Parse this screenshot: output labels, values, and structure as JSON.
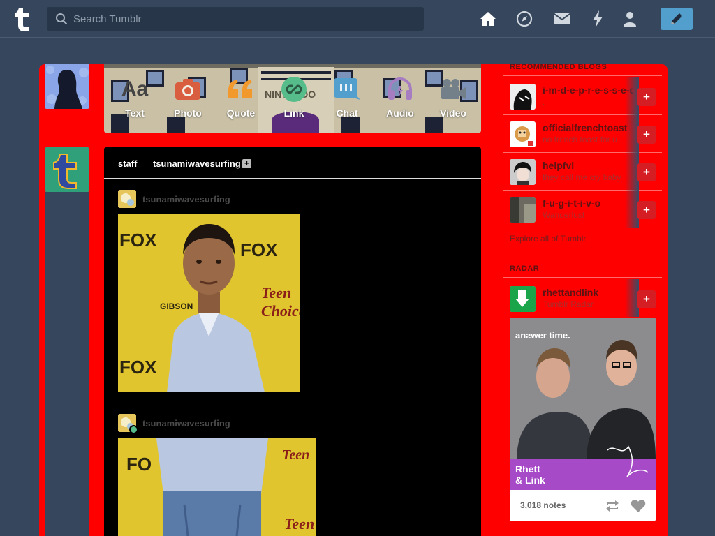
{
  "topbar": {
    "search_placeholder": "Search Tumblr",
    "nav_icons": [
      "home-icon",
      "explore-icon",
      "inbox-icon",
      "activity-icon",
      "account-icon"
    ],
    "compose_icon": "pencil-icon",
    "colors": {
      "background": "#36465d",
      "search_bg": "#273649",
      "compose_bg": "#529ecc"
    }
  },
  "post_types": [
    {
      "label": "Text",
      "icon": "text-icon",
      "color": "#444444"
    },
    {
      "label": "Photo",
      "icon": "camera-icon",
      "color": "#d95e40"
    },
    {
      "label": "Quote",
      "icon": "quote-icon",
      "color": "#f2992e"
    },
    {
      "label": "Link",
      "icon": "link-icon",
      "color": "#56bc8a"
    },
    {
      "label": "Chat",
      "icon": "chat-icon",
      "color": "#529ecc"
    },
    {
      "label": "Audio",
      "icon": "headphones-icon",
      "color": "#a77dc2"
    },
    {
      "label": "Video",
      "icon": "video-icon",
      "color": "#748089"
    }
  ],
  "dashboard": {
    "reblog_header": {
      "from": "staff",
      "to": "tsunamiwavesurfing",
      "plus": "+"
    },
    "posts": [
      {
        "blog": "tsunamiwavesurfing"
      },
      {
        "blog": "tsunamiwavesurfing"
      }
    ]
  },
  "sidebar": {
    "recommended_title": "RECOMMENDED BLOGS",
    "blogs": [
      {
        "name": "i-m-d-e-p-r-e-s-s-e-d",
        "subtitle": "."
      },
      {
        "name": "officialfrenchtoast",
        "subtitle": "no french toast for u"
      },
      {
        "name": "helpfvl",
        "subtitle": "they call me cry baby"
      },
      {
        "name": "f-u-g-i-t-i-v-o",
        "subtitle": "Wanderlust"
      }
    ],
    "follow_label": "+",
    "explore_label": "Explore all of Tumblr",
    "radar_title": "RADAR",
    "radar_blog": {
      "name": "rhettandlink",
      "subtitle": "Tumblr Radar"
    },
    "radar_card": {
      "banner": "anƨwer time.",
      "caption_line1": "Rhett",
      "caption_line2": "& Link",
      "notes": "3,018 notes"
    }
  },
  "colors": {
    "accent_red": "#ff0000",
    "dash_bg": "#000000"
  }
}
